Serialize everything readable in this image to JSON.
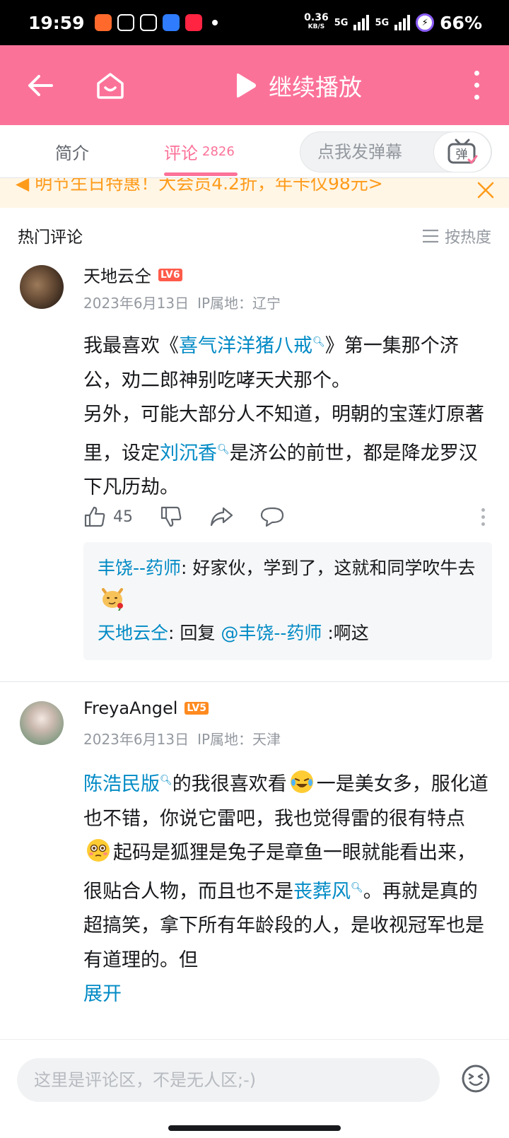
{
  "status_bar": {
    "time": "19:59",
    "speed_value": "0.36",
    "speed_unit": "KB/S",
    "net1": "5G",
    "net2": "5G",
    "battery": "66%"
  },
  "header": {
    "continue_label": "继续播放",
    "accent": "#fb7299"
  },
  "tabs": {
    "intro": "简介",
    "comments": "评论",
    "comments_count": "2826",
    "danmaku_placeholder": "点我发弹幕",
    "danmaku_btn": "弹"
  },
  "promo": {
    "text": "明节生日特惠！大会员4.2折，年卡仅98元>"
  },
  "section": {
    "title": "热门评论",
    "sort_label": "按热度"
  },
  "comments": [
    {
      "user": "天地云仝",
      "level": "LV6",
      "date": "2023年6月13日",
      "ip": "IP属地：辽宁",
      "p1_a": "我最喜欢《",
      "p1_link": "喜气洋洋猪八戒",
      "p1_b": "》第一集那个济公，劝二郎神别吃哮天犬那个。",
      "p2_a": "另外，可能大部分人不知道，明朝的宝莲灯原著里，设定",
      "p2_link": "刘沉香",
      "p2_b": "是济公的前世，都是降龙罗汉下凡历劫。",
      "likes": "45",
      "reply1_user": "丰饶--药师",
      "reply1_text": ": 好家伙，学到了，这就和同学吹牛去",
      "reply2_user": "天地云仝",
      "reply2_mid": ": 回复 ",
      "reply2_mention": "@丰饶--药师",
      "reply2_text": " :啊这"
    },
    {
      "user": "FreyaAngel",
      "level": "LV5",
      "date": "2023年6月13日",
      "ip": "IP属地：天津",
      "link1": "陈浩民版",
      "t1": "的我很喜欢看",
      "t2": "一是美女多，服化道也不错，你说它雷吧，我也觉得雷的很有特点",
      "t3": "起码是狐狸是兔子是章鱼一眼就能看出来，很贴合人物，而且也不是",
      "link2": "丧葬风",
      "t4": "。再就是真的超搞笑，拿下所有年龄段的人，是收视冠军也是有道理的。但",
      "expand": "展开"
    }
  ],
  "bottom": {
    "input_placeholder": "这里是评论区，不是无人区;-)"
  }
}
